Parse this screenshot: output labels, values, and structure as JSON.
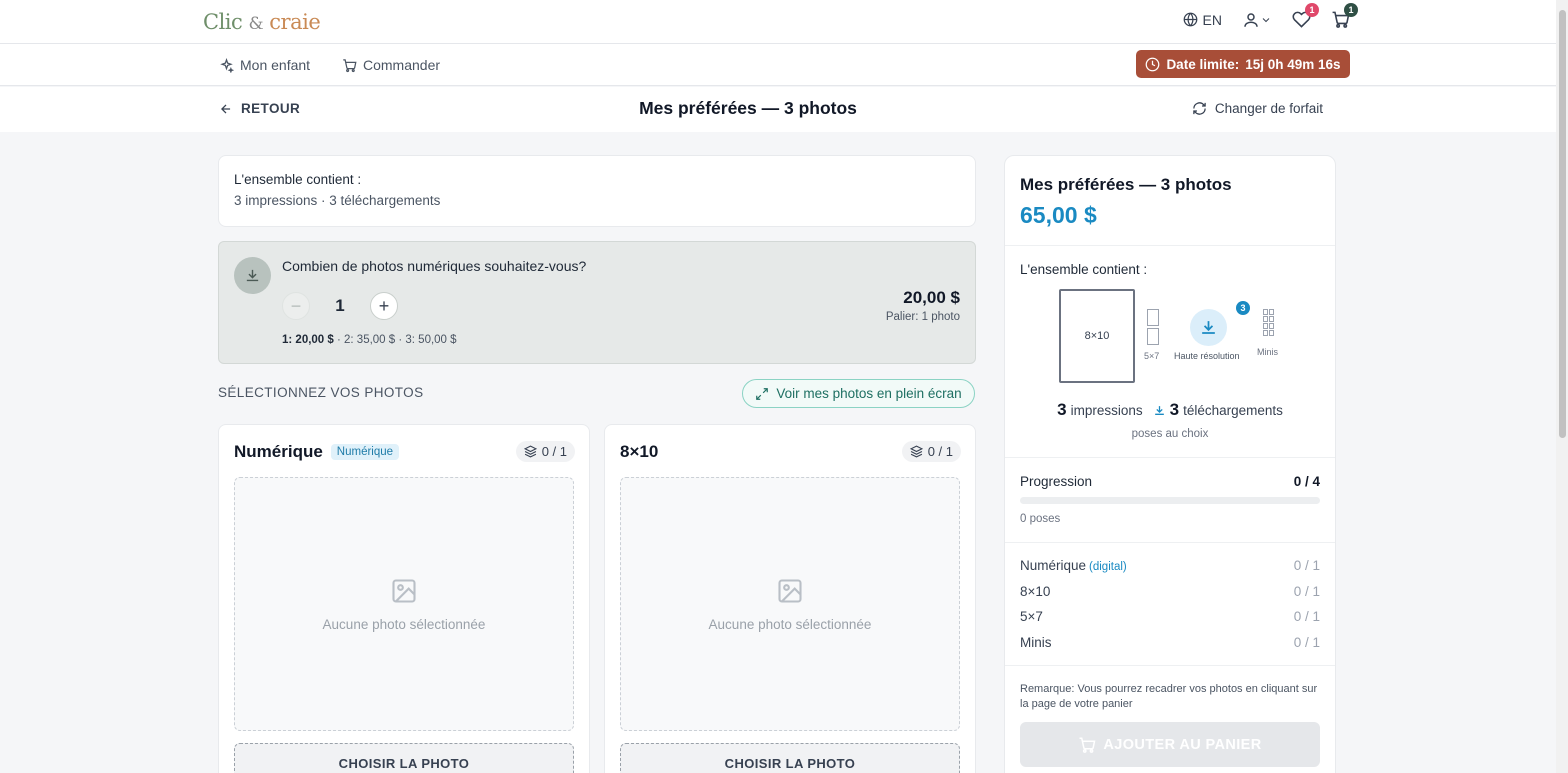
{
  "header": {
    "logo_part1": "Clic",
    "logo_amp": "&",
    "logo_part2": "craie",
    "language": "EN",
    "wishlist_count": "1",
    "cart_count": "1"
  },
  "nav": {
    "my_child": "Mon enfant",
    "order": "Commander",
    "deadline_label": "Date limite:",
    "deadline_value": "15j 0h 49m 16s"
  },
  "subbar": {
    "back": "RETOUR",
    "title": "Mes préférées — 3 photos",
    "change_plan": "Changer de forfait"
  },
  "contents": {
    "heading": "L'ensemble contient :",
    "summary": "3 impressions · 3 téléchargements"
  },
  "digital": {
    "question": "Combien de photos numériques souhaitez-vous?",
    "quantity": "1",
    "price": "20,00 $",
    "tier": "Palier: 1 photo",
    "tier1": "1: 20,00 $",
    "tier_rest": " · 2: 35,00 $ · 3: 50,00 $"
  },
  "selection": {
    "heading": "SÉLECTIONNEZ VOS PHOTOS",
    "fullscreen": "Voir mes photos en plein écran"
  },
  "slots": [
    {
      "title": "Numérique",
      "tag": "Numérique",
      "count": "0 / 1",
      "empty": "Aucune photo sélectionnée",
      "button": "CHOISIR LA PHOTO"
    },
    {
      "title": "8×10",
      "tag": "",
      "count": "0 / 1",
      "empty": "Aucune photo sélectionnée",
      "button": "CHOISIR LA PHOTO"
    }
  ],
  "panel": {
    "title": "Mes préférées — 3 photos",
    "price": "65,00 $",
    "contains": "L'ensemble contient :",
    "print_big": "8×10",
    "print_small": "5×7",
    "hires_label": "Haute résolution",
    "hires_count": "3",
    "minis_label": "Minis",
    "impressions_count": "3",
    "impressions_label": "impressions",
    "downloads_count": "3",
    "downloads_label": "téléchargements",
    "poses": "poses au choix",
    "progress_label": "Progression",
    "progress_value": "0 / 4",
    "progress_fraction": 0,
    "progress_sub": "0 poses",
    "formats": [
      {
        "name": "Numérique",
        "hint": "(digital)",
        "value": "0 / 1"
      },
      {
        "name": "8×10",
        "hint": "",
        "value": "0 / 1"
      },
      {
        "name": "5×7",
        "hint": "",
        "value": "0 / 1"
      },
      {
        "name": "Minis",
        "hint": "",
        "value": "0 / 1"
      }
    ],
    "note": "Remarque: Vous pourrez recadrer vos photos en cliquant sur la page de votre panier",
    "add_to_cart": "AJOUTER AU PANIER"
  },
  "colors": {
    "accent": "#1a8ac2",
    "deadline": "#a84e38",
    "fullscreen_border": "#8bd3c4"
  }
}
